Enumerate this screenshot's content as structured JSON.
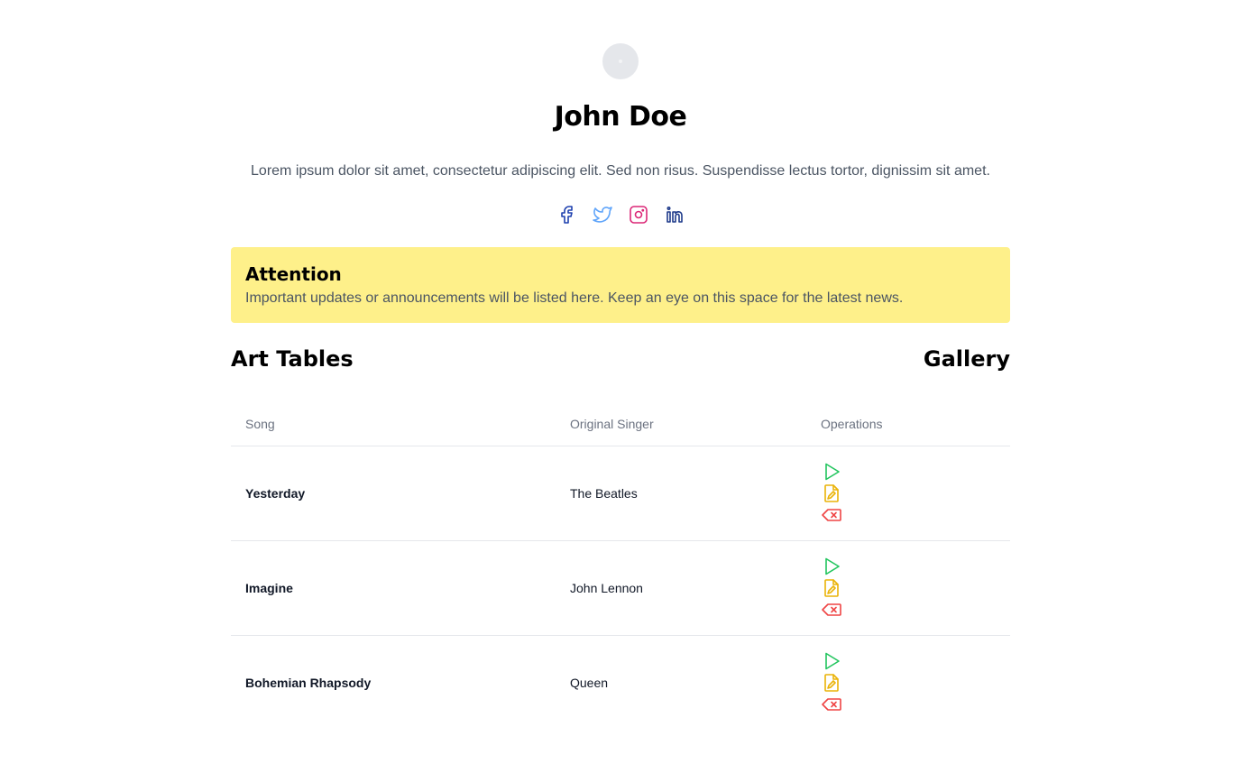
{
  "profile": {
    "name": "John Doe",
    "bio": "Lorem ipsum dolor sit amet, consectetur adipiscing elit. Sed non risus. Suspendisse lectus tortor, dignissim sit amet."
  },
  "socials": [
    {
      "icon": "facebook-icon",
      "color": "#1e40af"
    },
    {
      "icon": "twitter-icon",
      "color": "#60a5fa"
    },
    {
      "icon": "instagram-icon",
      "color": "#db2777"
    },
    {
      "icon": "linkedin-icon",
      "color": "#1e3a8a"
    }
  ],
  "alert": {
    "title": "Attention",
    "text": "Important updates or announcements will be listed here. Keep an eye on this space for the latest news.",
    "background": "#fef08a"
  },
  "section": {
    "title": "Art Tables",
    "link": "Gallery"
  },
  "table": {
    "headers": [
      "Song",
      "Original Singer",
      "Operations"
    ],
    "rows": [
      {
        "song": "Yesterday",
        "singer": "The Beatles"
      },
      {
        "song": "Imagine",
        "singer": "John Lennon"
      },
      {
        "song": "Bohemian Rhapsody",
        "singer": "Queen"
      }
    ],
    "operations": [
      {
        "icon": "play-icon",
        "color": "#22c55e"
      },
      {
        "icon": "edit-file-icon",
        "color": "#eab308"
      },
      {
        "icon": "delete-tag-icon",
        "color": "#ef4444"
      }
    ]
  }
}
